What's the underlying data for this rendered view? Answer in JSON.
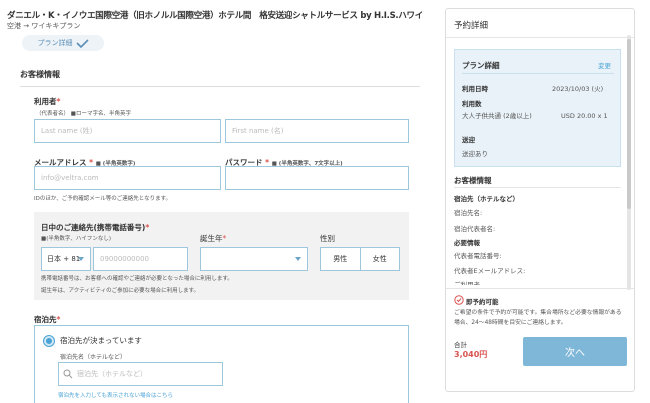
{
  "header": {
    "title": "ダニエル・K・イノウエ国際空港（旧ホノルル国際空港）ホテル間　格安送迎シャトルサービス by H.I.S.ハワイ",
    "subtitle": "空港 → ワイキキプラン",
    "plan_detail_pill": "プラン詳細"
  },
  "customer_section": {
    "heading": "お客様情報",
    "user_label": "利用者",
    "user_note": "（代表者名）",
    "user_note2": "■ローマ字名、半角英字",
    "last_name_placeholder": "Last name (姓)",
    "first_name_placeholder": "First name (名)",
    "email_label": "メールアドレス",
    "email_note": "■ (半角英数字)",
    "email_placeholder": "info@veltra.com",
    "password_label": "パスワード",
    "password_note": "■ (半角英数字、7文字以上)",
    "id_note": "IDのほか、ご予約確認メール等のご連絡先となります。",
    "phone_label": "日中のご連絡先(携帯電話番号)",
    "phone_note": "■(半角数字、ハイフンなし)",
    "country_code": "日本 + 81",
    "phone_placeholder": "09000000000",
    "birth_label": "誕生年",
    "gender_label": "性別",
    "gender_male": "男性",
    "gender_female": "女性",
    "phone_help1": "携帯電話番号は、お客様への確認やご連絡が必要となった場合に利用します。",
    "phone_help2": "誕生年は、アクティビティのご参加に必要な場合に利用します。",
    "lodging_label": "宿泊先",
    "lodging_option": "宿泊先が決まっています",
    "hotel_name_label": "宿泊先名（ホテルなど）",
    "hotel_search_placeholder": "宿泊先（ホテルなど）",
    "hotel_not_found_link": "宿泊先を入力しても表示されない場合はこちら"
  },
  "summary": {
    "heading": "予約詳細",
    "plan_detail": "プラン詳細",
    "change_link": "変更",
    "date_label": "利用日時",
    "date_value": "2023/10/03 (火)",
    "count_label": "利用数",
    "count_item": "大人子供共通 (2歳以上)",
    "count_price": "USD 20.00 x 1",
    "transfer_label": "送迎",
    "transfer_value": "送迎あり",
    "customer_heading": "お客様情報",
    "lodging_heading": "宿泊先（ホテルなど）",
    "lodging_name": "宿泊先名:",
    "lodging_rep": "宿泊代表者名:",
    "required_heading": "必要情報",
    "rep_phone": "代表者電話番号:",
    "rep_email": "代表者Eメールアドレス:",
    "rep_more": "ご利用者",
    "instant_label": "即予約可能",
    "instant_note": "ご希望の条件で予約が可能です。集合場所など必要な情報がある場合、24〜48時間を目安にご連絡します。",
    "total_label": "合計",
    "total_value": "3,040円",
    "next_button": "次へ"
  },
  "colors": {
    "accent": "#4aa3d6",
    "required": "#d9534f",
    "price": "#d9534f",
    "button": "#7fb7d9"
  }
}
